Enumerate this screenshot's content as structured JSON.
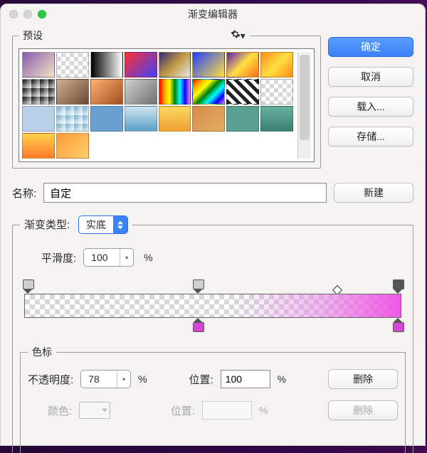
{
  "window": {
    "title": "渐变编辑器"
  },
  "buttons": {
    "ok": "确定",
    "cancel": "取消",
    "load": "载入...",
    "save": "存储...",
    "new": "新建",
    "delete": "删除",
    "delete2": "删除"
  },
  "presets": {
    "legend": "预设",
    "gear_icon": "gear"
  },
  "name": {
    "label": "名称:",
    "value": "自定"
  },
  "gradient": {
    "type_label": "渐变类型:",
    "type_value": "实底",
    "smoothness_label": "平滑度:",
    "smoothness_value": "100",
    "pct": "%"
  },
  "stops": {
    "legend": "色标",
    "opacity_label": "不透明度:",
    "opacity_value": "78",
    "opacity_unit": "%",
    "position_label": "位置:",
    "position_value": "100",
    "position_unit": "%",
    "color_label": "颜色:",
    "position2_label": "位置:",
    "position2_value": "",
    "position2_unit": "%"
  }
}
